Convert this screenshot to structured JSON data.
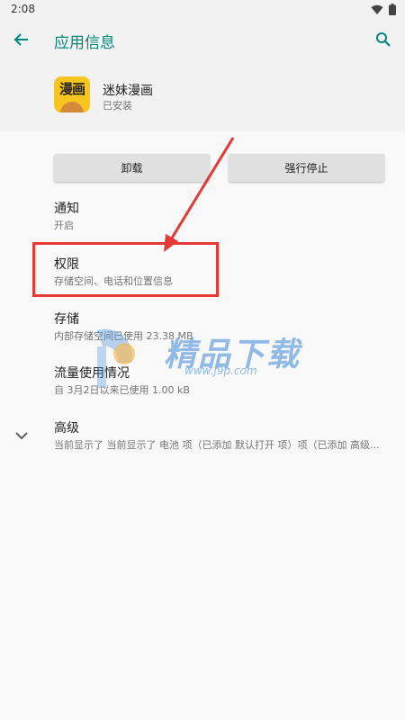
{
  "status_bar": {
    "time": "2:08",
    "icons": [
      "wifi-icon",
      "battery-icon"
    ]
  },
  "app_bar": {
    "title": "应用信息",
    "back_icon": "arrow-back-icon",
    "search_icon": "search-icon"
  },
  "app": {
    "name": "迷妹漫画",
    "status": "已安装",
    "icon_text": "漫画"
  },
  "buttons": {
    "uninstall": "卸载",
    "force_stop": "强行停止"
  },
  "items": [
    {
      "title": "通知",
      "summary": "开启"
    },
    {
      "title": "权限",
      "summary": "存储空间、电话和位置信息"
    },
    {
      "title": "存储",
      "summary": "内部存储空间已使用 23.38 MB"
    },
    {
      "title": "流量使用情况",
      "summary": "自 3月2日以来已使用 1.00 kB"
    },
    {
      "title": "高级",
      "summary": "当前显示了 当前显示了 电池 项（已添加 默认打开 项）项（已添加 高级..."
    }
  ],
  "watermark": {
    "text": "精品下载",
    "url": "www.j9p.com"
  },
  "colors": {
    "accent": "#00897b",
    "highlight": "#e53935",
    "background": "#f9f9f9",
    "header": "#f2f2f2"
  }
}
